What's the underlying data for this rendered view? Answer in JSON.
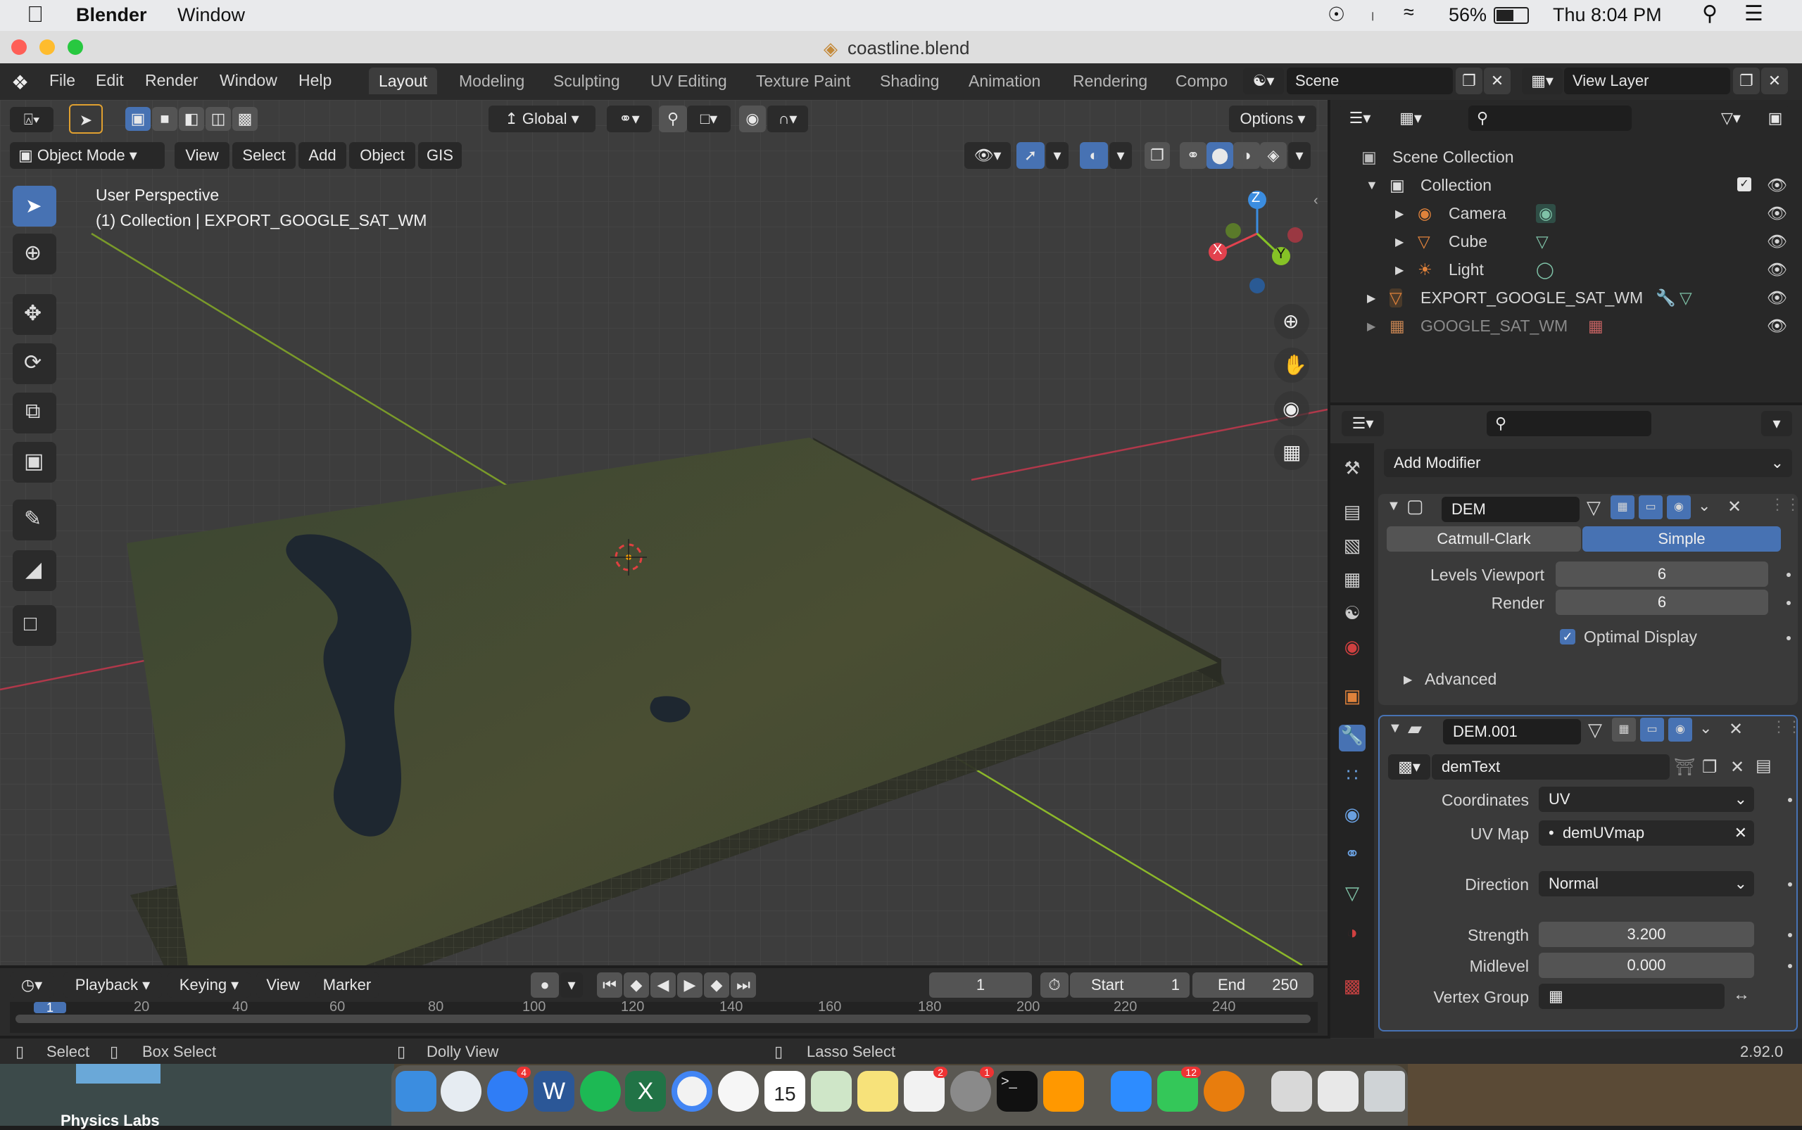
{
  "macbar": {
    "app_name": "Blender",
    "menu_window": "Window",
    "battery": "56%",
    "clock": "Thu 8:04 PM"
  },
  "window": {
    "title": "coastline.blend"
  },
  "topbar": {
    "menus": [
      "File",
      "Edit",
      "Render",
      "Window",
      "Help"
    ],
    "workspaces": [
      "Layout",
      "Modeling",
      "Sculpting",
      "UV Editing",
      "Texture Paint",
      "Shading",
      "Animation",
      "Rendering",
      "Compo"
    ],
    "active_workspace": "Layout",
    "scene": "Scene",
    "view_layer": "View Layer"
  },
  "viewport": {
    "transform_orientation": "Global",
    "options_label": "Options",
    "mode": "Object Mode",
    "header_menus": [
      "View",
      "Select",
      "Add",
      "Object",
      "GIS"
    ],
    "overlay_title": "User Perspective",
    "overlay_subtitle": "(1) Collection | EXPORT_GOOGLE_SAT_WM",
    "gizmo_axes": {
      "x": "X",
      "y": "Y",
      "z": "Z"
    }
  },
  "outliner": {
    "root": "Scene Collection",
    "collection": "Collection",
    "items": [
      "Camera",
      "Cube",
      "Light"
    ],
    "export_obj": "EXPORT_GOOGLE_SAT_WM",
    "image_obj": "GOOGLE_SAT_WM"
  },
  "properties": {
    "add_modifier": "Add Modifier",
    "mod1": {
      "name": "DEM",
      "tab_catmull": "Catmull-Clark",
      "tab_simple": "Simple",
      "levels_viewport_label": "Levels Viewport",
      "levels_viewport": "6",
      "render_label": "Render",
      "render": "6",
      "optimal_display": "Optimal Display",
      "advanced": "Advanced"
    },
    "mod2": {
      "name": "DEM.001",
      "texture": "demText",
      "coordinates_label": "Coordinates",
      "coordinates": "UV",
      "uvmap_label": "UV Map",
      "uvmap": "demUVmap",
      "direction_label": "Direction",
      "direction": "Normal",
      "strength_label": "Strength",
      "strength": "3.200",
      "midlevel_label": "Midlevel",
      "midlevel": "0.000",
      "vertex_group_label": "Vertex Group"
    }
  },
  "timeline": {
    "menus": [
      "Playback",
      "Keying",
      "View",
      "Marker"
    ],
    "current_frame": "1",
    "start_label": "Start",
    "start": "1",
    "end_label": "End",
    "end": "250",
    "ruler": [
      "1",
      "20",
      "40",
      "60",
      "80",
      "100",
      "120",
      "140",
      "160",
      "180",
      "200",
      "220",
      "240"
    ]
  },
  "statusbar": {
    "select": "Select",
    "box_select": "Box Select",
    "dolly": "Dolly View",
    "lasso": "Lasso Select",
    "version": "2.92.0"
  },
  "dock": {
    "badges": {
      "messages": "4",
      "reminders": "2",
      "prefs": "1",
      "facetime": "12"
    },
    "calendar_day": "15",
    "wallpaper_text": "Physics Labs"
  },
  "colors": {
    "accent": "#4772b3",
    "x_axis": "#e2424e",
    "y_axis": "#86c226",
    "z_axis": "#3b8de0",
    "modifier_icon": "#7fc2a7"
  }
}
